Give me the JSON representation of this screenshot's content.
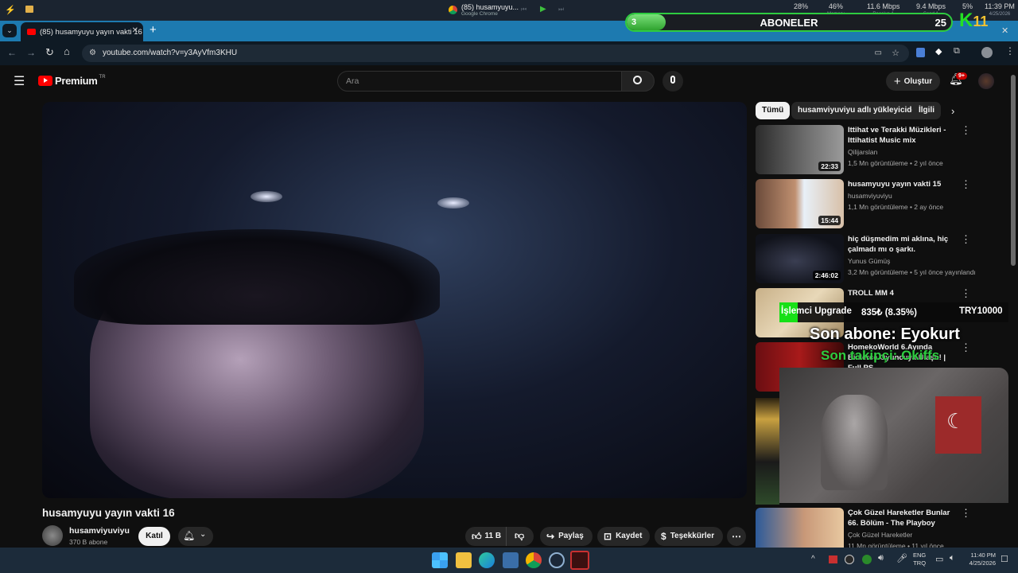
{
  "system_bar": {
    "media_title": "(85) husamyuyu...",
    "media_app": "Google Chrome",
    "cpu": "28%",
    "memory": "46%",
    "memory_label": "Memory",
    "receive": "11.6 Mbps",
    "receive_label": "Receive 1",
    "send": "9.4 Mbps",
    "send_label": "Send 1",
    "gpu": "5%",
    "clock": "11:39 PM",
    "date": "4/25/2026"
  },
  "overlay": {
    "subscribers_label": "ABONELER",
    "subscribers_current": "3",
    "subscribers_goal": "25",
    "subscribers_progress": 0.12,
    "logo_letter": "K",
    "logo_number": "11",
    "upgrade_text": "İşlemci Upgrade",
    "upgrade_amount": "835₺ (8.35%)",
    "upgrade_goal": "TRY10000",
    "last_sub": "Son abone: Eyokurt",
    "last_follow": "Son takipçi: Okiffs"
  },
  "tabs": [
    {
      "title": "(85) husamyuyu yayın vakti 16"
    }
  ],
  "address": {
    "url": "youtube.com/watch?v=y3AyVfm3KHU"
  },
  "youtube": {
    "logo_text": "Premium",
    "region": "TR",
    "search_placeholder": "Ara",
    "create_label": "Oluştur",
    "notif_badge": "9+",
    "chips": [
      "Tümü",
      "husamviyuviyu adlı yükleyiciden",
      "İlgili"
    ],
    "video": {
      "title": "husamyuyu yayın vakti 16",
      "channel": "husamviyuviyu",
      "subscribers": "370 B abone",
      "join_label": "Katıl",
      "likes": "11 B",
      "share_label": "Paylaş",
      "save_label": "Kaydet",
      "thanks_label": "Teşekkürler"
    },
    "recommendations": [
      {
        "title": "Ittihat ve Terakki Müzikleri - Ittihatist Music mix",
        "channel": "Qilijarslan",
        "meta": "1,5 Mn görüntüleme • 2 yıl önce",
        "duration": "22:33"
      },
      {
        "title": "husamyuyu yayın vakti 15",
        "channel": "husamviyuviyu",
        "meta": "1,1 Mn görüntüleme • 2 ay önce",
        "duration": "15:44"
      },
      {
        "title": "hiç düşmedim mi aklına, hiç çalmadı mı o şarkı.",
        "channel": "Yunus Gümüş",
        "meta": "3,2 Mn görüntüleme • 5 yıl önce yayınlandı",
        "duration": "2:46:02"
      },
      {
        "title": "TROLL MM 4",
        "channel": "",
        "meta": "",
        "duration": ""
      },
      {
        "title": "HomekoWorld 6.Ayında Binlerce Oyuncuya Ulaştı! | Full PS",
        "channel": "",
        "meta": "",
        "duration": ""
      },
      {
        "title": "Çok Güzel Hareketler Bunlar 66. Bölüm - The Playboy",
        "channel": "Çok Güzel Hareketler",
        "meta": "11 Mn görüntüleme • 11 yıl önce",
        "duration": ""
      }
    ]
  },
  "taskbar": {
    "lang": "ENG",
    "kbd": "TRQ",
    "clock": "11:40 PM",
    "date": "4/25/2026"
  }
}
